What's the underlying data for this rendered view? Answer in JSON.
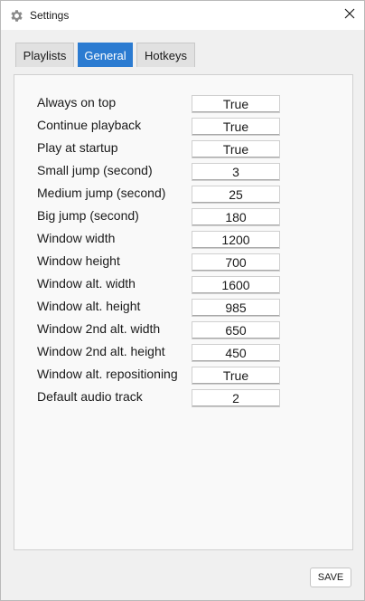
{
  "window": {
    "title": "Settings",
    "icon": "gear-icon",
    "close_icon": "close-icon"
  },
  "tabs": [
    {
      "label": "Playlists",
      "active": false
    },
    {
      "label": "General",
      "active": true
    },
    {
      "label": "Hotkeys",
      "active": false
    }
  ],
  "settings": [
    {
      "label": "Always on top",
      "value": "True"
    },
    {
      "label": "Continue playback",
      "value": "True"
    },
    {
      "label": "Play at startup",
      "value": "True"
    },
    {
      "label": "Small jump (second)",
      "value": "3"
    },
    {
      "label": "Medium jump (second)",
      "value": "25"
    },
    {
      "label": "Big jump (second)",
      "value": "180"
    },
    {
      "label": "Window width",
      "value": "1200"
    },
    {
      "label": "Window height",
      "value": "700"
    },
    {
      "label": "Window alt. width",
      "value": "1600"
    },
    {
      "label": "Window alt. height",
      "value": "985"
    },
    {
      "label": "Window 2nd alt. width",
      "value": "650"
    },
    {
      "label": "Window 2nd alt. height",
      "value": "450"
    },
    {
      "label": "Window alt. repositioning",
      "value": "True"
    },
    {
      "label": "Default audio track",
      "value": "2"
    }
  ],
  "footer": {
    "save_label": "SAVE"
  },
  "colors": {
    "active_tab": "#2b7bd1"
  }
}
